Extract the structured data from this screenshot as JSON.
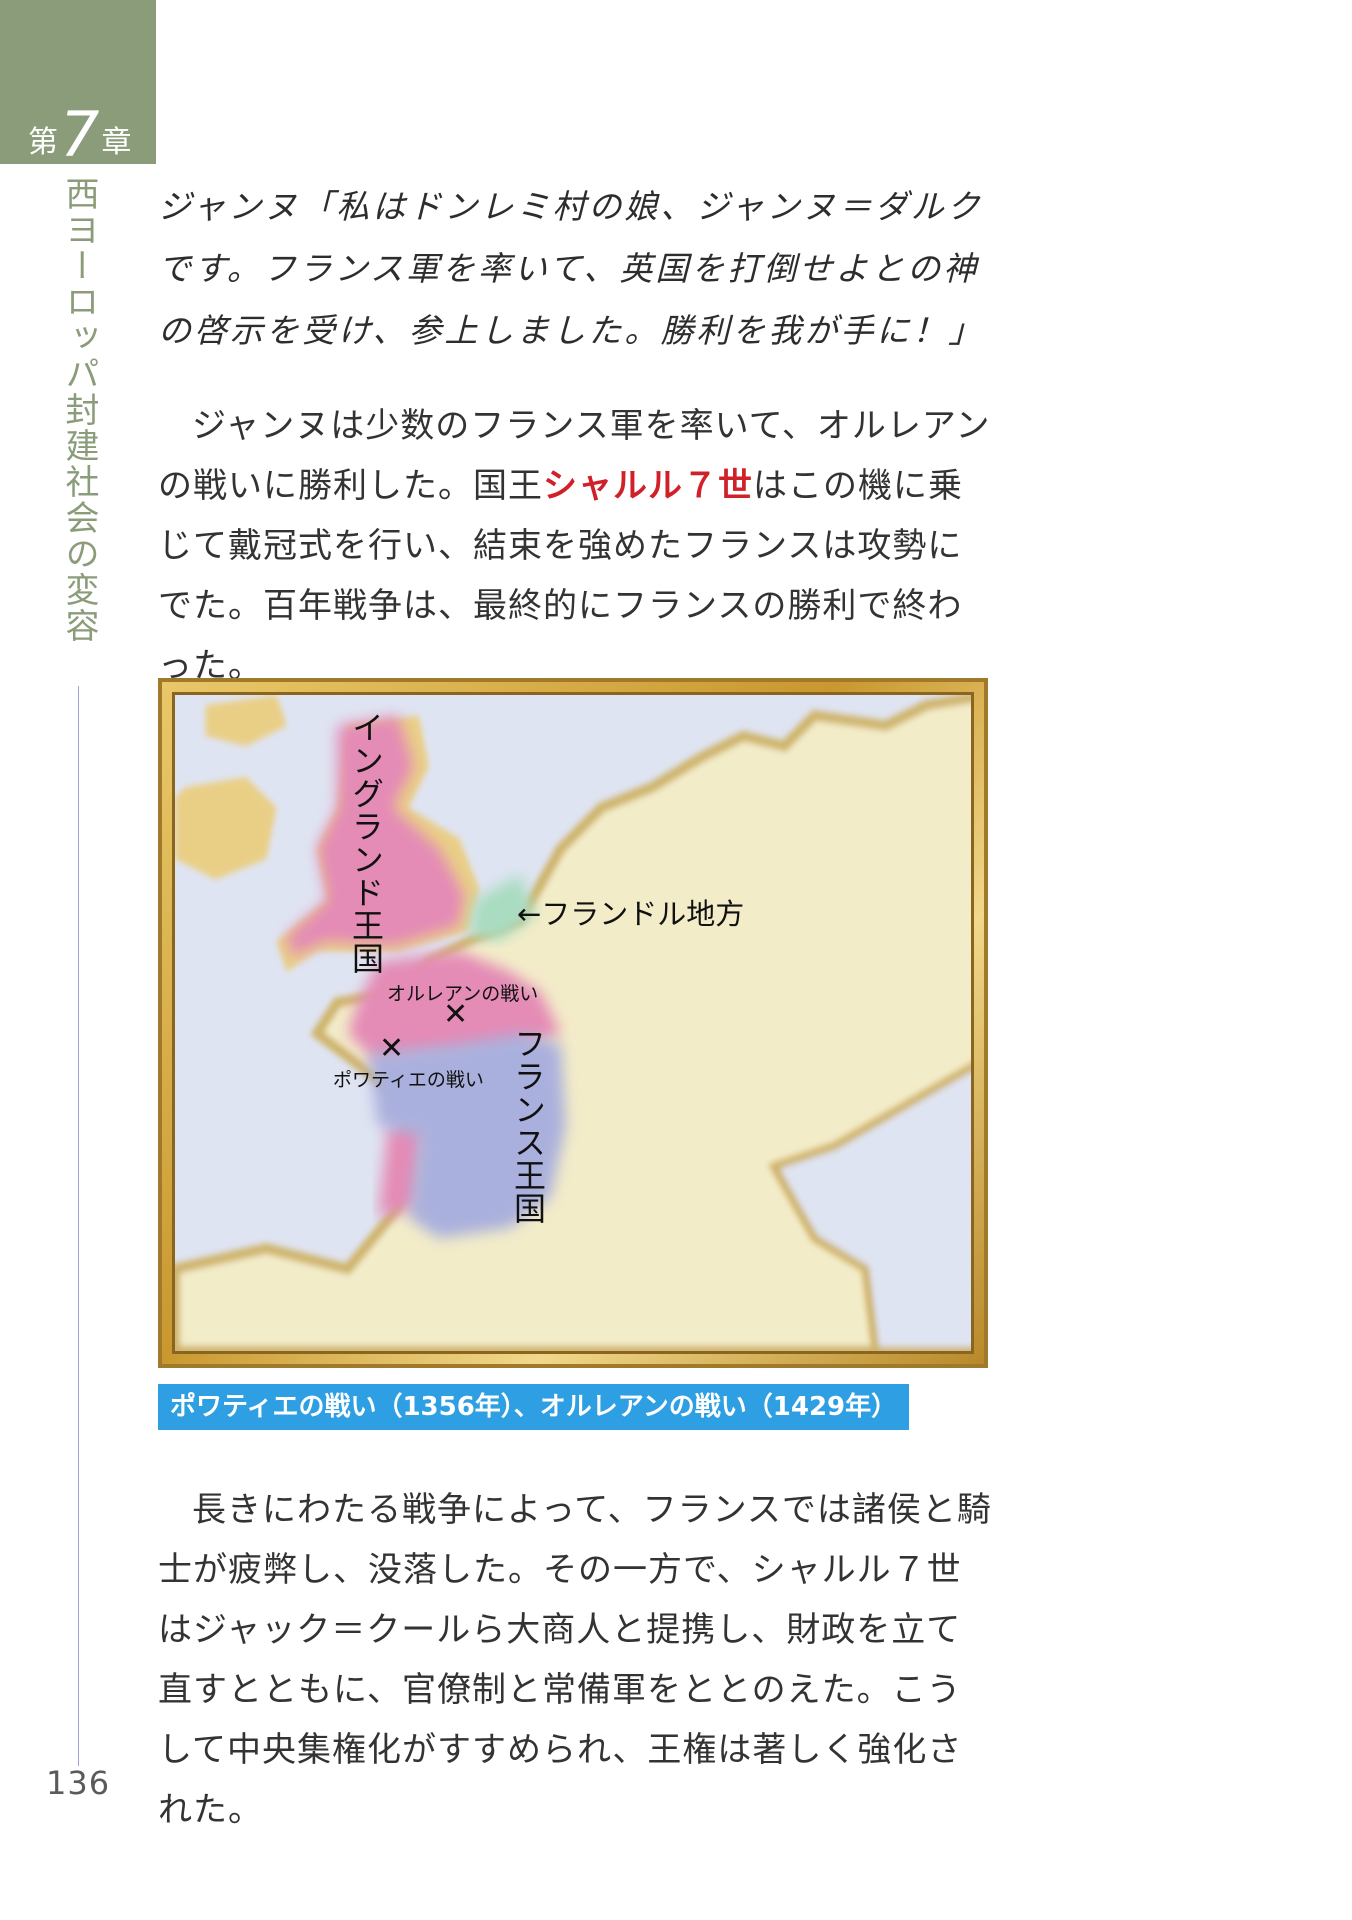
{
  "chapter": {
    "prefix": "第",
    "number": "7",
    "suffix": "章"
  },
  "side_title": "西ヨーロッパ封建社会の変容",
  "quote": {
    "text": "ジャンヌ「私はドンレミ村の娘、ジャンヌ＝ダルクです。フランス軍を率いて、英国を打倒せよとの神の啓示を受け、参上しました。勝利を我が手に！」"
  },
  "paragraph1": {
    "before": "ジャンヌは少数のフランス軍を率いて、オルレアンの戦いに勝利した。国王",
    "highlight": "シャルル７世",
    "after": "はこの機に乗じて戴冠式を行い、結束を強めたフランスは攻勢にでた。百年戦争は、最終的にフランスの勝利で終わった。"
  },
  "map": {
    "labels": {
      "england": "イングランド王国",
      "france": "フランス王国",
      "flanders": "←フランドル地方",
      "orleans": "オルレアンの戦い",
      "poitiers": "ポワティエの戦い"
    },
    "battle_marker": "✕",
    "colors": {
      "sea": "#dfe4f2",
      "land": "#f3ecc9",
      "coast": "#cfb46a",
      "england": "#e48bb6",
      "france": "#aab0dd",
      "flanders": "#a9dcc0"
    }
  },
  "caption": "ポワティエの戦い（1356年）、オルレアンの戦い（1429年）",
  "paragraph2": {
    "text": "長きにわたる戦争によって、フランスでは諸侯と騎士が疲弊し、没落した。その一方で、シャルル７世はジャック＝クールら大商人と提携し、財政を立て直すとともに、官僚制と常備軍をととのえた。こうして中央集権化がすすめられ、王権は著しく強化された。"
  },
  "page_number": "136"
}
